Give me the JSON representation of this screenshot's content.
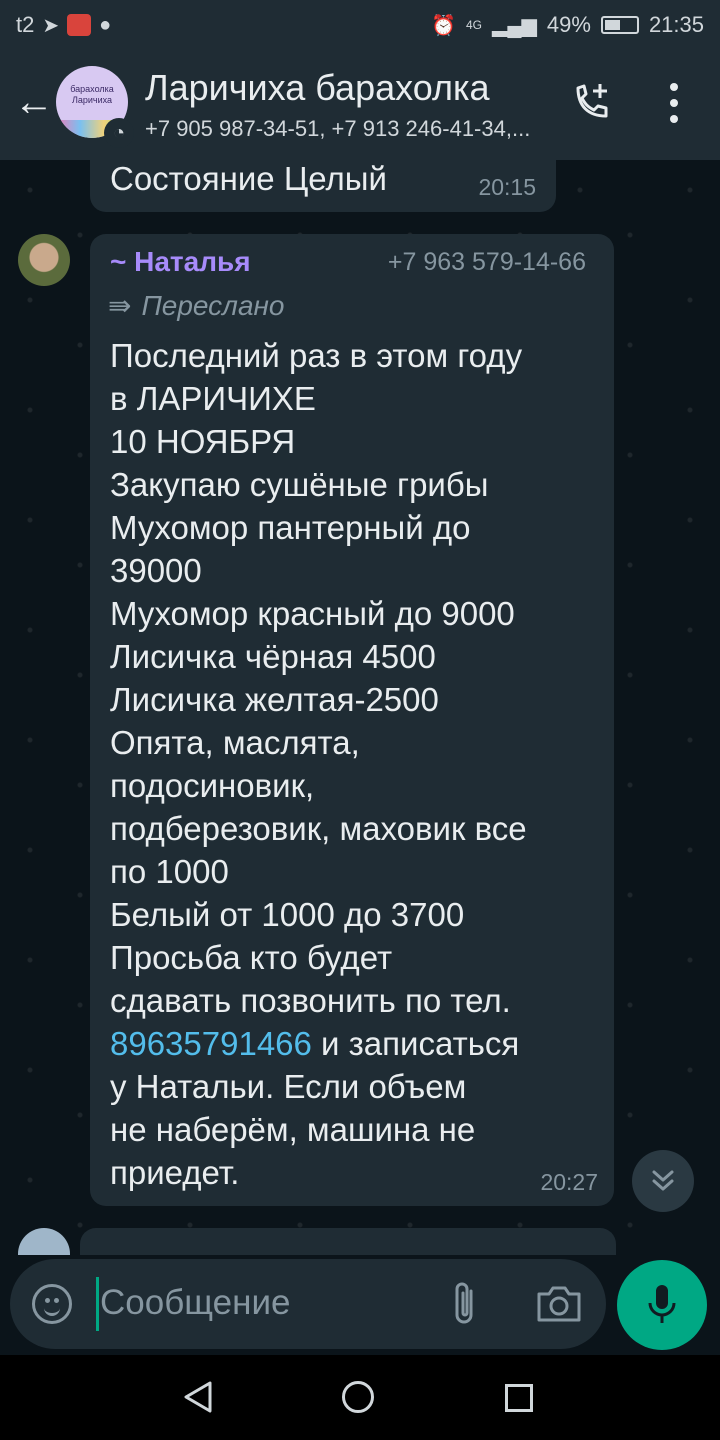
{
  "status_bar": {
    "carrier": "t2",
    "network": "4G",
    "battery": "49%",
    "time": "21:35"
  },
  "header": {
    "back_label": "←",
    "avatar_text": "барахолка Ларичиха",
    "title": "Ларичиха барахолка",
    "subtitle": "+7 905 987-34-51, +7 913 246-41-34,..."
  },
  "messages": [
    {
      "text": "Состояние Целый",
      "time": "20:15"
    },
    {
      "sender": "~ Наталья",
      "sender_phone": "+7 963 579-14-66",
      "forwarded_label": "Переслано",
      "lines": [
        "Последний раз в этом году",
        "в ЛАРИЧИХЕ",
        "10 НОЯБРЯ",
        "Закупаю сушёные грибы",
        "Мухомор пантерный до",
        "39000",
        "Мухомор красный до 9000",
        "Лисичка чёрная 4500",
        "Лисичка желтая-2500",
        "Опята, маслята,",
        "подосиновик,",
        "подберезовик, маховик все",
        "по 1000",
        "Белый от 1000 до 3700",
        "Просьба кто будет",
        "сдавать позвонить по тел."
      ],
      "phone_link": "89635791466",
      "after_link": " и записаться",
      "tail_lines": [
        "у Натальи. Если объем",
        "не наберём, машина не",
        "приедет."
      ],
      "time": "20:27"
    }
  ],
  "composer": {
    "placeholder": "Сообщение"
  },
  "colors": {
    "accent": "#00a884",
    "bubble": "#1f2c34",
    "background": "#0b141a",
    "sender": "#a78bfa",
    "link": "#53bdeb"
  }
}
